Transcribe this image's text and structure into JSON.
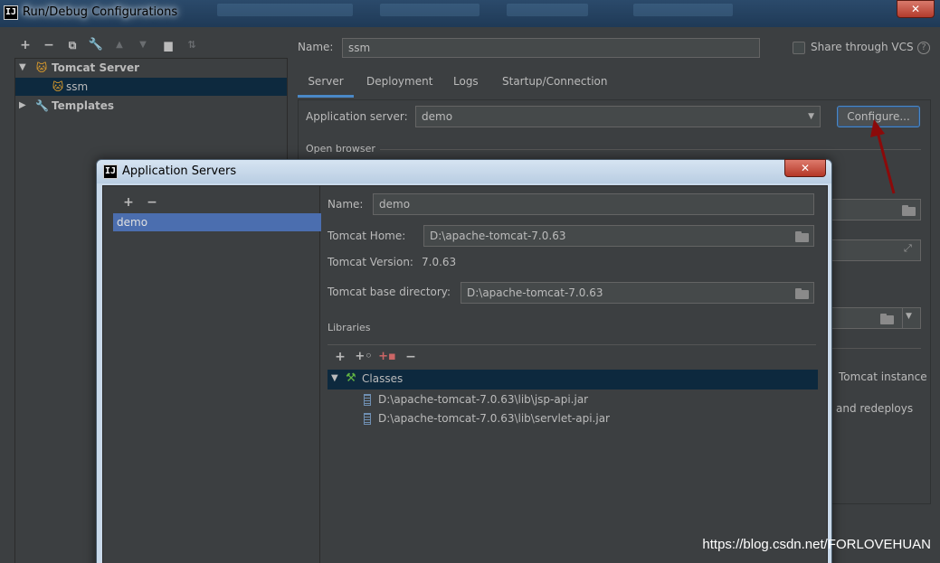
{
  "window": {
    "title": "Run/Debug Configurations",
    "close_icon": "close-x-icon"
  },
  "left_toolbar": {
    "icons": [
      "add-icon",
      "remove-icon",
      "copy-icon",
      "wrench-icon",
      "move-up-icon",
      "move-down-icon",
      "folder-add-icon",
      "sort-icon"
    ]
  },
  "tree": {
    "group": "Tomcat Server",
    "selected_item": "ssm",
    "templates": "Templates"
  },
  "config": {
    "name_label": "Name:",
    "name_value": "ssm",
    "share_label": "Share through VCS",
    "help_glyph": "?",
    "tabs": [
      "Server",
      "Deployment",
      "Logs",
      "Startup/Connection"
    ],
    "active_tab": "Server",
    "app_server_label": "Application server:",
    "app_server_value": "demo",
    "configure_button": "Configure...",
    "open_browser": "Open browser",
    "behind_text_1": "Tomcat instance",
    "behind_text_2": "and redeploys"
  },
  "dialog": {
    "title": "Application Servers",
    "list_add": "+",
    "list_remove": "−",
    "list_items": [
      "demo"
    ],
    "name_label": "Name:",
    "name_value": "demo",
    "home_label": "Tomcat Home:",
    "home_value": "D:\\apache-tomcat-7.0.63",
    "version_label": "Tomcat Version:",
    "version_value": "7.0.63",
    "base_dir_label": "Tomcat base directory:",
    "base_dir_value": "D:\\apache-tomcat-7.0.63",
    "libraries_label": "Libraries",
    "lib_toolbar": [
      "add-icon",
      "add-root-icon",
      "add-jar-icon",
      "remove-icon"
    ],
    "classes_label": "Classes",
    "jars": [
      "D:\\apache-tomcat-7.0.63\\lib\\jsp-api.jar",
      "D:\\apache-tomcat-7.0.63\\lib\\servlet-api.jar"
    ]
  },
  "watermark": "https://blog.csdn.net/FORLOVEHUAN",
  "colors": {
    "background": "#3c3f41",
    "selection": "#0d293e",
    "list_selection": "#4b6eaf",
    "accent": "#4a88c7",
    "arrow": "#8b0a0a"
  }
}
